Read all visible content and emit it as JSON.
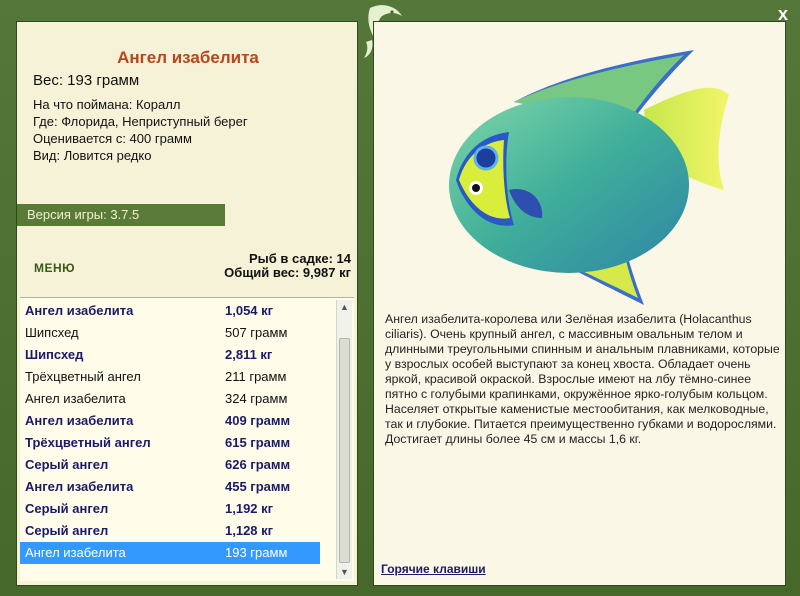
{
  "window": {
    "close_label": "x"
  },
  "fish": {
    "name": "Ангел изабелита",
    "weight": "Вес: 193 грамм",
    "info": [
      "На что поймана: Коралл",
      "Где: Флорида, Неприступный берег",
      "Оценивается с: 400 грамм",
      "Вид: Ловится редко"
    ]
  },
  "version": "Версия игры: 3.7.5",
  "menu_label": "МЕНЮ",
  "stats": {
    "cage": "Рыб в садке: 14",
    "total": "Общий вес: 9,987 кг"
  },
  "catch_list": [
    {
      "name": "Ангел изабелита",
      "weight": "1,054 кг",
      "style": "bold"
    },
    {
      "name": "Шипсхед",
      "weight": "507 грамм",
      "style": "norm"
    },
    {
      "name": "Шипсхед",
      "weight": "2,811 кг",
      "style": "bold"
    },
    {
      "name": "Трёхцветный ангел",
      "weight": "211 грамм",
      "style": "norm"
    },
    {
      "name": "Ангел изабелита",
      "weight": "324 грамм",
      "style": "norm"
    },
    {
      "name": "Ангел изабелита",
      "weight": "409 грамм",
      "style": "bold"
    },
    {
      "name": "Трёхцветный ангел",
      "weight": "615 грамм",
      "style": "bold"
    },
    {
      "name": "Серый ангел",
      "weight": "626 грамм",
      "style": "bold"
    },
    {
      "name": "Ангел изабелита",
      "weight": "455 грамм",
      "style": "bold"
    },
    {
      "name": "Серый ангел",
      "weight": "1,192 кг",
      "style": "bold"
    },
    {
      "name": "Серый ангел",
      "weight": "1,128 кг",
      "style": "bold"
    },
    {
      "name": "Ангел изабелита",
      "weight": "193 грамм",
      "style": "sel"
    }
  ],
  "description": "Ангел изабелита-королева или Зелёная изабелита (Holacanthus ciliaris). Очень крупный ангел, с массивным овальным телом и длинными треугольными спинным и анальным плавниками, которые у взрослых особей выступают за конец хвоста. Обладает очень яркой, красивой окраской. Взрослые имеют на лбу тёмно-синее пятно с голубыми крапинками, окружённое ярко-голубым кольцом. Населяет открытые каменистые местообитания, как мелководные, так и глубокие. Питается преимущественно губками и водорослями. Достигает длины более 45 см и массы 1,6 кг.",
  "hotkeys_label": "Горячие клавиши",
  "icons": {
    "close": "close-icon",
    "logo": "fish-logo-icon",
    "scroll_up": "scroll-up-icon",
    "scroll_down": "scroll-down-icon"
  }
}
